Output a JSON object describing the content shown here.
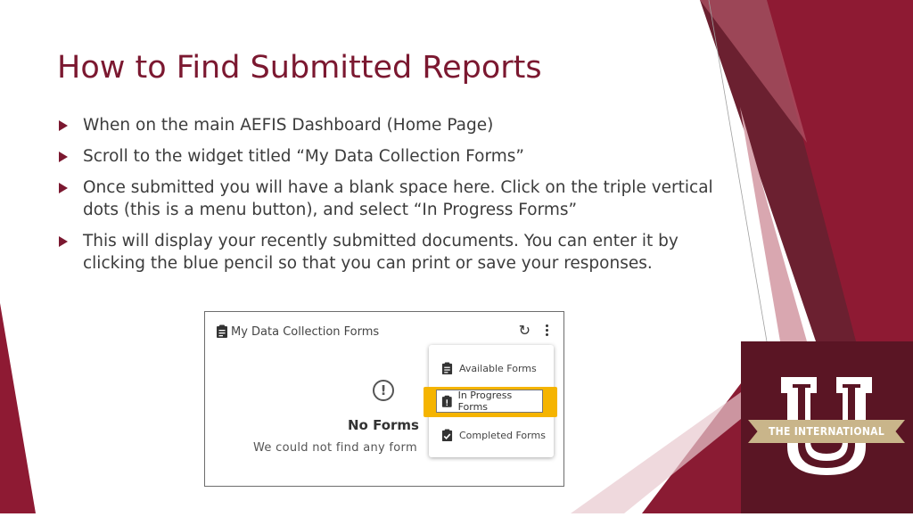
{
  "slide": {
    "title": "How to Find Submitted Reports",
    "bullets": [
      "When on the main AEFIS Dashboard (Home Page)",
      "Scroll to the widget titled “My Data Collection Forms”",
      "Once submitted you will have a blank space here. Click on the triple vertical dots (this is a menu button), and select “In Progress Forms”",
      "This will display your recently submitted documents. You can enter it by clicking the blue pencil so that you can print or save your responses."
    ]
  },
  "widget": {
    "title": "My Data Collection Forms",
    "empty_title": "No Forms",
    "empty_text": "We could not find any form",
    "menu": {
      "available": "Available Forms",
      "in_progress": "In Progress Forms",
      "completed": "Completed Forms"
    }
  },
  "logo": {
    "banner_text": "THE INTERNATIONAL"
  },
  "colors": {
    "accent": "#7b1830",
    "highlight": "#f5b400",
    "logo_background": "#5a1524",
    "banner": "#c9b58a"
  },
  "icons": {
    "bullet": "triangle-arrow-icon",
    "clipboard": "clipboard-icon",
    "refresh": "refresh-icon",
    "menu": "kebab-menu-icon",
    "alert": "alert-circle-icon"
  }
}
